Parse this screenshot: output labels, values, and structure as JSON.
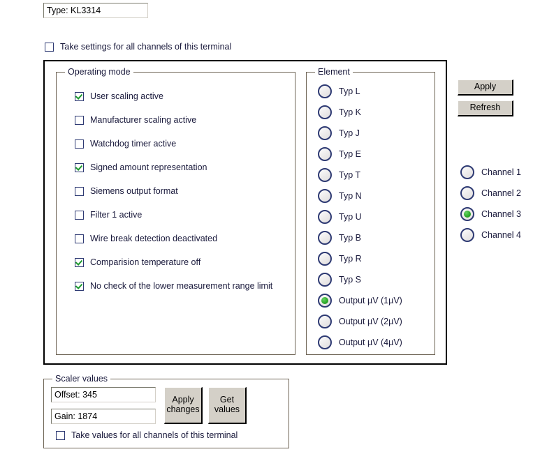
{
  "type_field": {
    "value": "Type: KL3314"
  },
  "take_settings": {
    "label": "Take settings for all channels of this terminal",
    "checked": false
  },
  "operating_mode": {
    "title": "Operating mode",
    "items": [
      {
        "label": "User scaling active",
        "checked": true
      },
      {
        "label": "Manufacturer scaling active",
        "checked": false
      },
      {
        "label": "Watchdog timer active",
        "checked": false
      },
      {
        "label": "Signed amount representation",
        "checked": true
      },
      {
        "label": "Siemens output format",
        "checked": false
      },
      {
        "label": "Filter 1 active",
        "checked": false
      },
      {
        "label": "Wire break detection deactivated",
        "checked": false
      },
      {
        "label": "Comparision temperature off",
        "checked": true
      },
      {
        "label": "No check of the lower measurement range limit",
        "checked": true
      }
    ]
  },
  "element": {
    "title": "Element",
    "items": [
      {
        "label": "Typ L",
        "selected": false
      },
      {
        "label": "Typ K",
        "selected": false
      },
      {
        "label": "Typ J",
        "selected": false
      },
      {
        "label": "Typ E",
        "selected": false
      },
      {
        "label": "Typ T",
        "selected": false
      },
      {
        "label": "Typ N",
        "selected": false
      },
      {
        "label": "Typ U",
        "selected": false
      },
      {
        "label": "Typ B",
        "selected": false
      },
      {
        "label": "Typ R",
        "selected": false
      },
      {
        "label": "Typ S",
        "selected": false
      },
      {
        "label": "Output µV (1µV)",
        "selected": true
      },
      {
        "label": "Output µV (2µV)",
        "selected": false
      },
      {
        "label": "Output µV (4µV)",
        "selected": false
      }
    ]
  },
  "actions": {
    "apply_label": "Apply",
    "refresh_label": "Refresh"
  },
  "channels": {
    "items": [
      {
        "label": "Channel 1",
        "selected": false
      },
      {
        "label": "Channel 2",
        "selected": false
      },
      {
        "label": "Channel 3",
        "selected": true
      },
      {
        "label": "Channel 4",
        "selected": false
      }
    ]
  },
  "scaler_values": {
    "title": "Scaler values",
    "offset_value": "Offset: 345",
    "gain_value": "Gain: 1874",
    "apply_changes_label": "Apply changes",
    "get_values_label": "Get values",
    "take_values": {
      "label": "Take values for all channels of this terminal",
      "checked": false
    }
  },
  "colors": {
    "check_green": "#1c9a2e",
    "radio_ring": "#2e3a73",
    "selected_dot_green": "#2faa2b",
    "groupbox_border": "#6e6455",
    "panel_border": "#000000",
    "button_face": "#d4d0c8",
    "text": "#1a1a3c"
  }
}
